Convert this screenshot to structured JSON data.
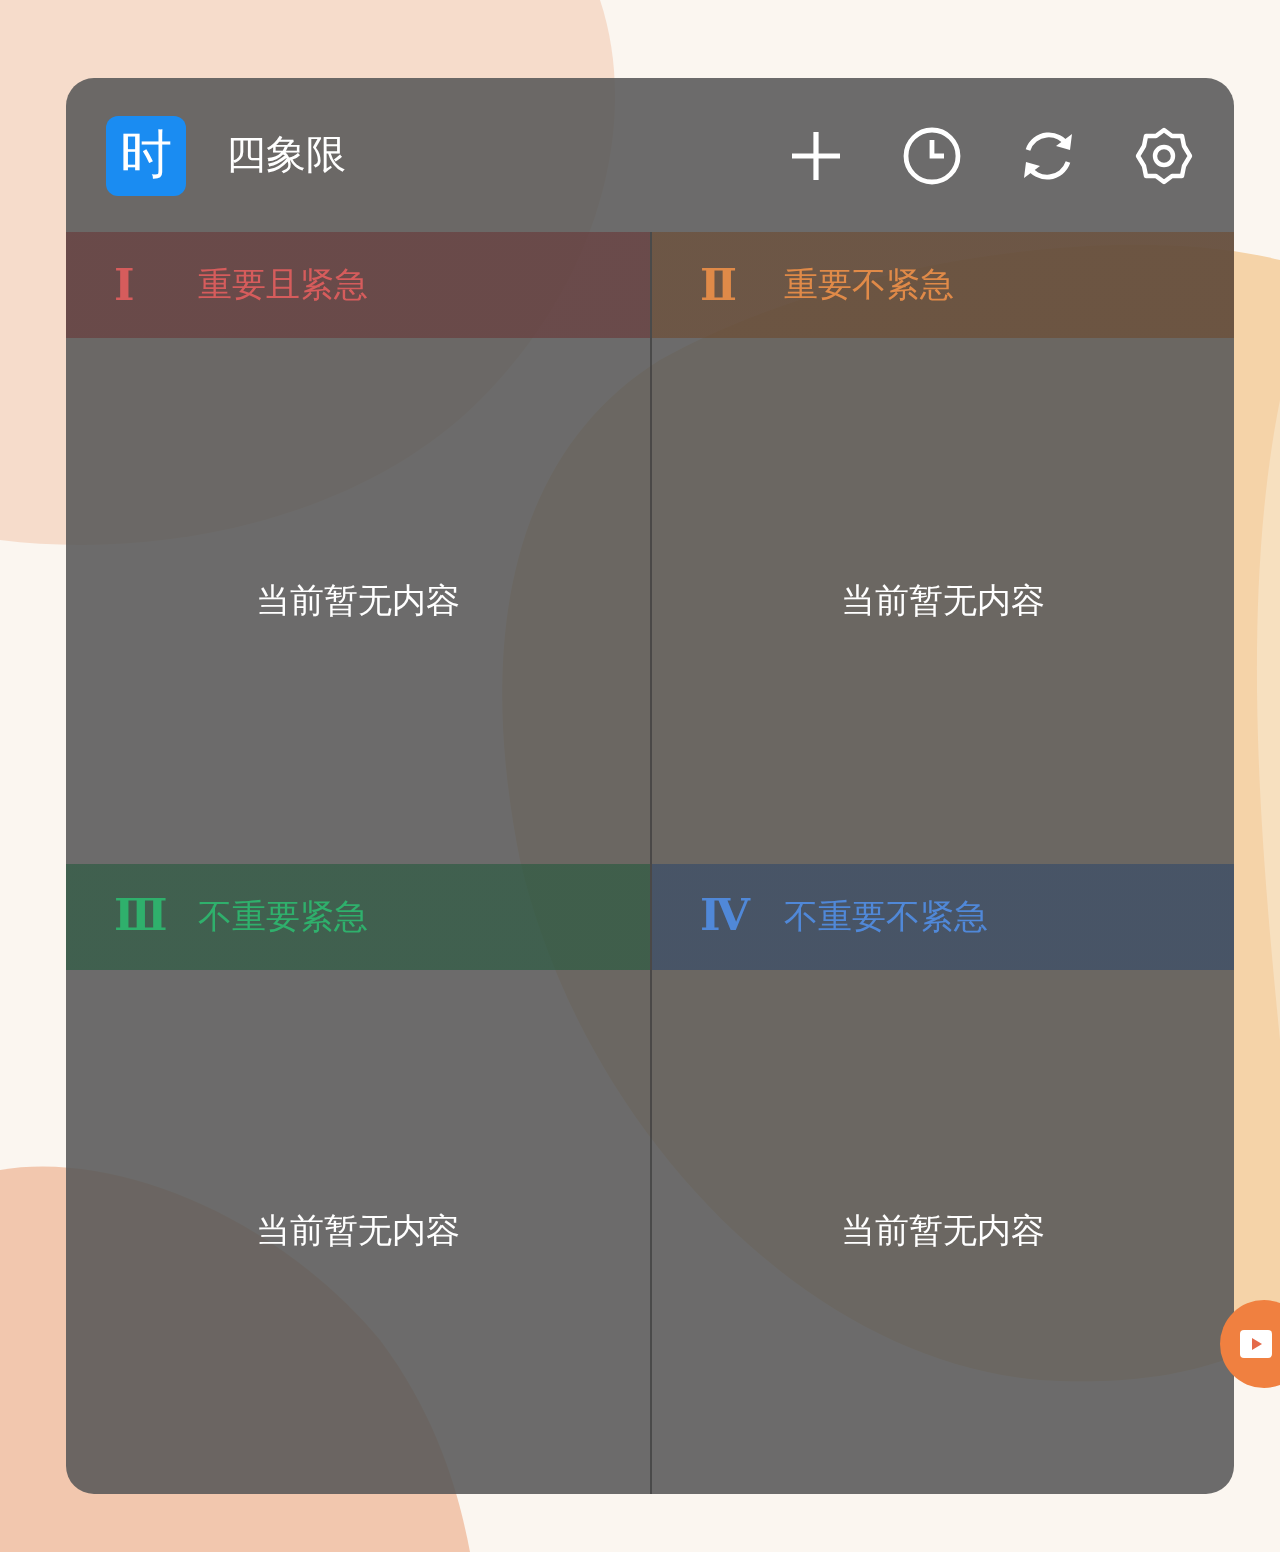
{
  "app": {
    "logo": "时",
    "title": "四象限"
  },
  "quadrants": [
    {
      "numeral": "Ⅰ",
      "label": "重要且紧急",
      "color": "#d65c5c",
      "empty": "当前暂无内容"
    },
    {
      "numeral": "Ⅱ",
      "label": "重要不紧急",
      "color": "#e08a48",
      "empty": "当前暂无内容"
    },
    {
      "numeral": "Ⅲ",
      "label": "不重要紧急",
      "color": "#2fb06c",
      "empty": "当前暂无内容"
    },
    {
      "numeral": "Ⅳ",
      "label": "不重要不紧急",
      "color": "#5088d8",
      "empty": "当前暂无内容"
    }
  ]
}
